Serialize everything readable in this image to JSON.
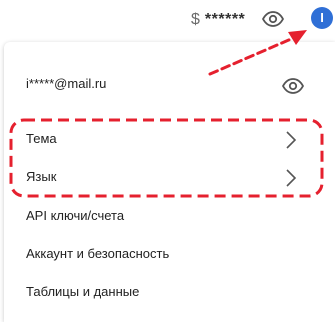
{
  "header": {
    "currency_symbol": "$",
    "balance_masked": "******",
    "eye_icon": "eye-icon",
    "avatar_letter": "I"
  },
  "menu": {
    "email": "i*****@mail.ru",
    "items": [
      {
        "label": "Тема",
        "chevron": true
      },
      {
        "label": "Язык",
        "chevron": true
      },
      {
        "label": "API ключи/счета",
        "chevron": false
      },
      {
        "label": "Аккаунт и безопасность",
        "chevron": false
      },
      {
        "label": "Таблицы и данные",
        "chevron": false
      }
    ]
  },
  "annotation": {
    "color": "#e5202e",
    "style": "dashed"
  },
  "colors": {
    "avatar": "#2f6fd6",
    "text": "#222222",
    "icon": "#555555"
  }
}
